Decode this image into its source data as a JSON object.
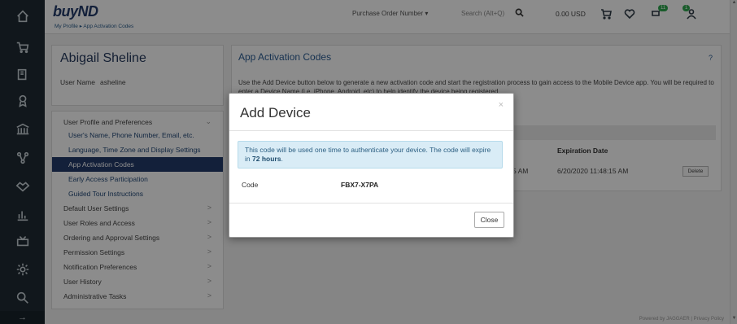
{
  "app": {
    "logo": "buyND"
  },
  "breadcrumb": {
    "text": "My Profile ▸ App Activation Codes"
  },
  "topbar": {
    "search_type": "Purchase Order Number ▾",
    "search_placeholder": "Search (Alt+Q)",
    "amount": "0.00 USD",
    "notification_badge": "11",
    "user_badge": "1"
  },
  "rail": {
    "icons": [
      "home-icon",
      "cart-icon",
      "documents-icon",
      "award-icon",
      "bank-icon",
      "network-icon",
      "handshake-icon",
      "chart-icon",
      "inbox-icon",
      "gear-icon",
      "search-icon"
    ],
    "collapse": "→"
  },
  "profile": {
    "name": "Abigail Sheline",
    "user_name_label": "User Name",
    "user_name_value": "asheline"
  },
  "menu": {
    "section_label": "User Profile and Preferences",
    "sub_items": [
      "User's Name, Phone Number, Email, etc.",
      "Language, Time Zone and Display Settings",
      "App Activation Codes",
      "Early Access Participation",
      "Guided Tour Instructions"
    ],
    "items": [
      "Default User Settings",
      "User Roles and Access",
      "Ordering and Approval Settings",
      "Permission Settings",
      "Notification Preferences",
      "User History",
      "Administrative Tasks"
    ]
  },
  "main": {
    "title": "App Activation Codes",
    "help": "?",
    "description": "Use the Add Device button below to generate a new activation code and start the registration process to gain access to the Mobile Device app. You will be required to enter a Device Name (i.e. iPhone, Android, etc) to help identify the device being registered.",
    "col_expiration": "Expiration Date",
    "row_time": "5 AM",
    "row_expiration": "6/20/2020 11:48:15 AM",
    "delete_label": "Delete"
  },
  "footer": {
    "text": "Powered by JAGGAER | Privacy Policy"
  },
  "modal": {
    "title": "Add Device",
    "close_x": "×",
    "alert_text": "This code will be used one time to authenticate your device. The code will expire in",
    "alert_hours": "72 hours",
    "alert_end": ".",
    "code_label": "Code",
    "code_value": "FBX7-X7PA",
    "close_label": "Close"
  }
}
